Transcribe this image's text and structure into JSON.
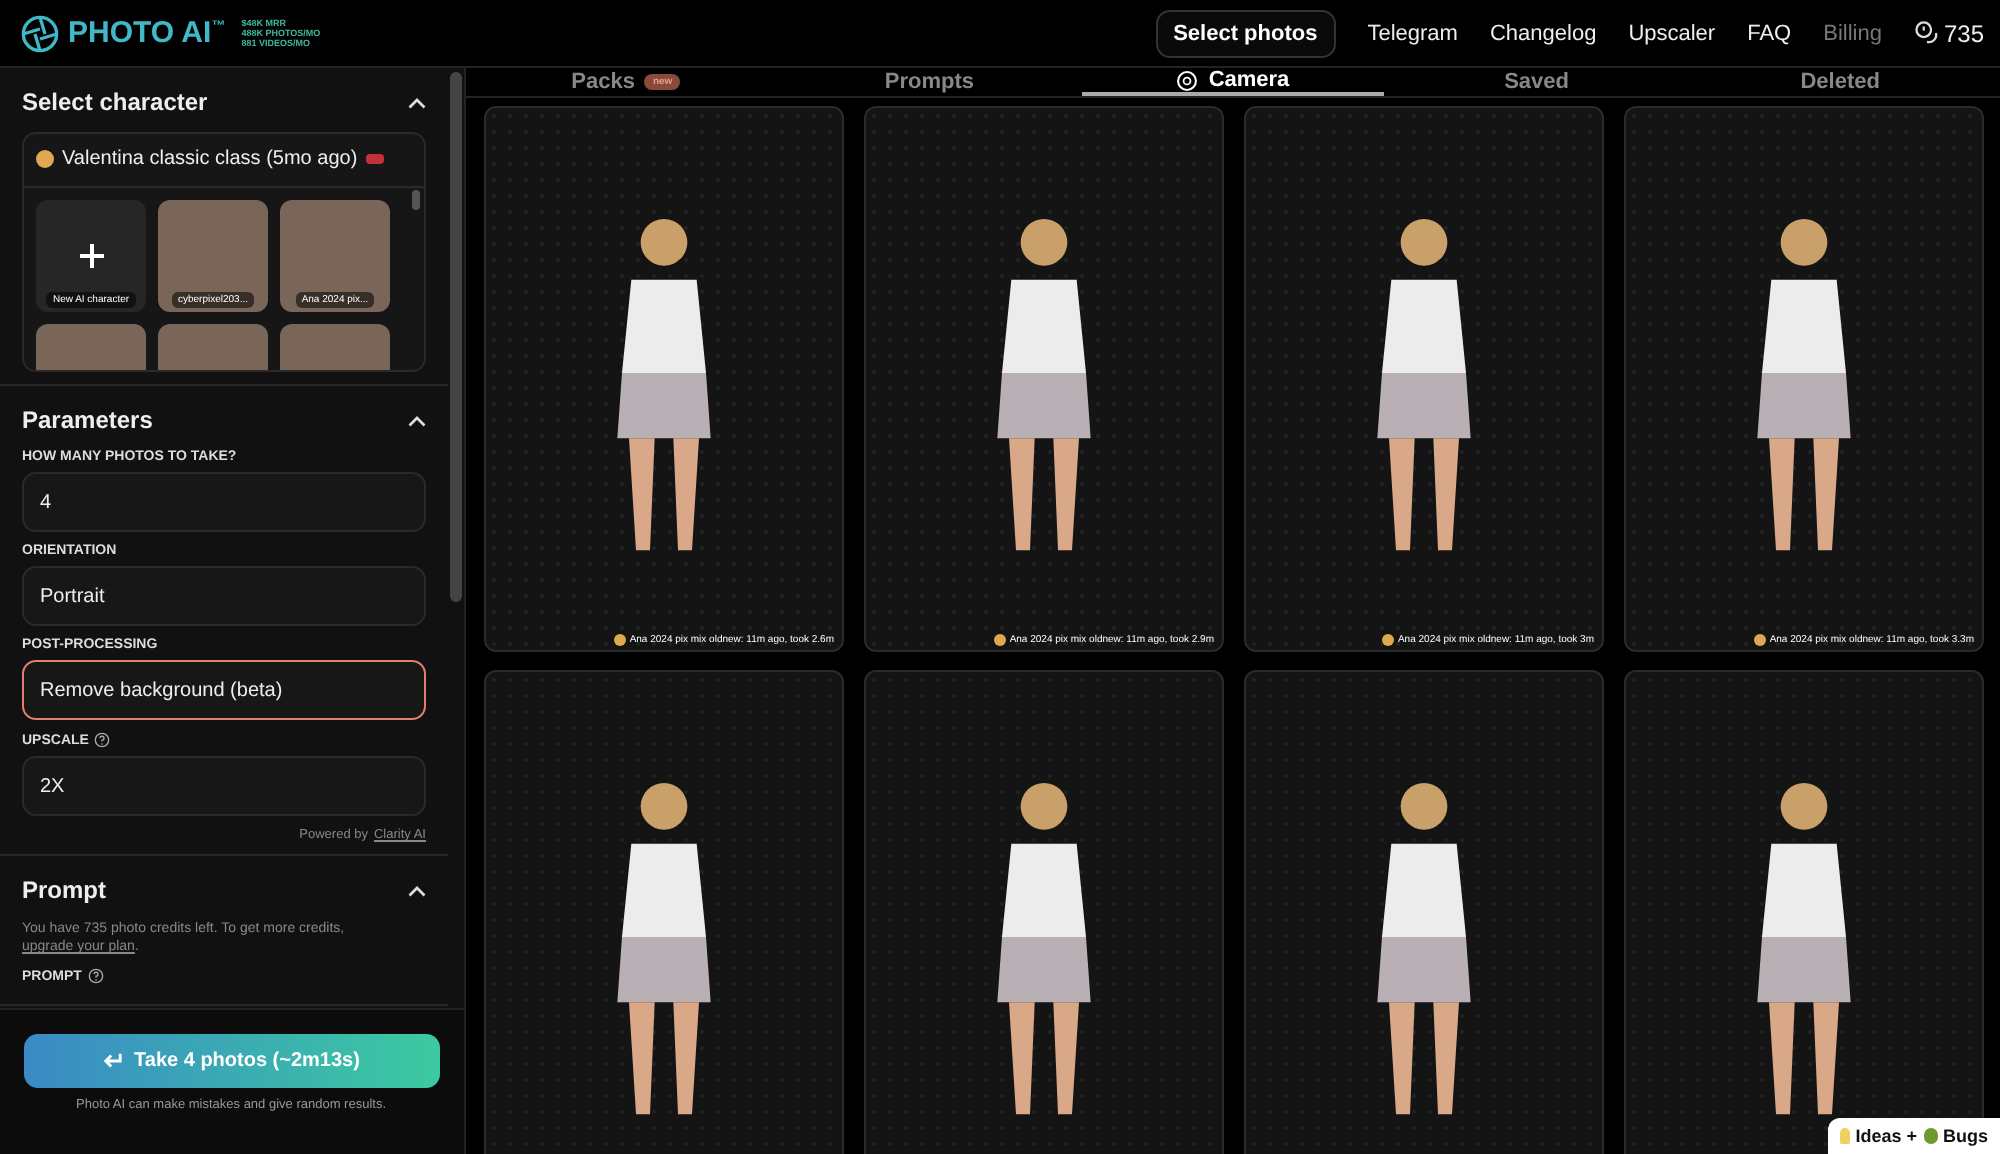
{
  "logo": {
    "name": "PHOTO AI",
    "mark": "™",
    "stats": [
      "$48K MRR",
      "488K PHOTOS/MO",
      "881 VIDEOS/MO"
    ]
  },
  "nav": [
    {
      "label": "Select photos",
      "kind": "button"
    },
    {
      "label": "Telegram",
      "kind": "link"
    },
    {
      "label": "Changelog",
      "kind": "link"
    },
    {
      "label": "Upscaler",
      "kind": "link"
    },
    {
      "label": "FAQ",
      "kind": "link"
    },
    {
      "label": "Billing",
      "kind": "muted"
    }
  ],
  "credits": "735",
  "character": {
    "title": "Select character",
    "selected": "Valentina classic class (5mo ago)",
    "items": [
      {
        "kind": "new",
        "label": "New AI character"
      },
      {
        "kind": "photo",
        "label": "cyberpixel203..."
      },
      {
        "kind": "photo",
        "label": "Ana 2024 pix..."
      },
      {
        "kind": "photo"
      },
      {
        "kind": "photo"
      },
      {
        "kind": "photo"
      }
    ]
  },
  "parameters": {
    "title": "Parameters",
    "fields": [
      {
        "label": "HOW MANY PHOTOS TO TAKE?",
        "value": "4",
        "help": false,
        "highlighted": false
      },
      {
        "label": "ORIENTATION",
        "value": "Portrait",
        "help": false,
        "highlighted": false
      },
      {
        "label": "POST-PROCESSING",
        "value": "Remove background (beta)",
        "help": false,
        "highlighted": true
      },
      {
        "label": "UPSCALE",
        "value": "2X",
        "help": true,
        "highlighted": false
      }
    ],
    "powered_by": "Powered by",
    "powered_link": "Clarity AI"
  },
  "prompt": {
    "title": "Prompt",
    "credits_text": "You have 735 photo credits left. To get more credits,",
    "upgrade_link": "upgrade your plan",
    "period": ".",
    "label": "PROMPT"
  },
  "take_button": "Take 4 photos (~2m13s)",
  "disclaimer": "Photo AI can make mistakes and give random results.",
  "tabs": [
    {
      "label": "Packs",
      "badge": "new",
      "selected": false
    },
    {
      "label": "Prompts",
      "selected": false
    },
    {
      "label": "Camera",
      "selected": true
    },
    {
      "label": "Saved",
      "selected": false
    },
    {
      "label": "Deleted",
      "selected": false
    }
  ],
  "photos": [
    {
      "kind": "finished",
      "caption": "Ana 2024 pix mix oldnew: 11m ago, took 2.6m"
    },
    {
      "kind": "finished",
      "caption": "Ana 2024 pix mix oldnew: 11m ago, took 2.9m"
    },
    {
      "kind": "finished",
      "caption": "Ana 2024 pix mix oldnew: 11m ago, took 3m"
    },
    {
      "kind": "finished",
      "caption": "Ana 2024 pix mix oldnew: 11m ago, took 3.3m"
    },
    {
      "kind": "photo"
    },
    {
      "kind": "photo"
    },
    {
      "kind": "photo"
    },
    {
      "kind": "photo"
    }
  ],
  "feedback": {
    "ideas": "Ideas +",
    "bugs": "Bugs"
  }
}
